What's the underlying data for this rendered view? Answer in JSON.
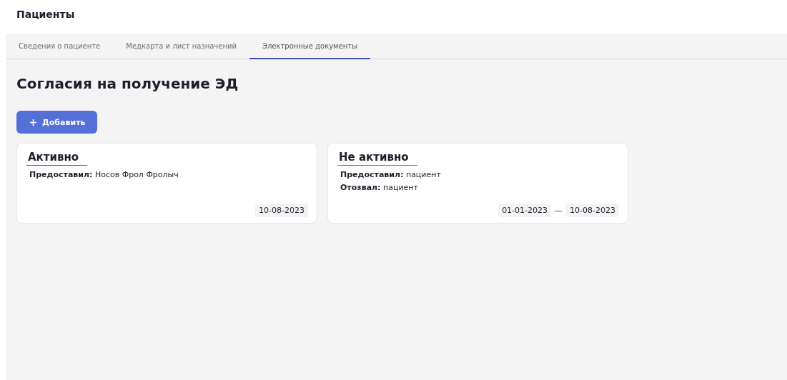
{
  "header": {
    "title": "Пациенты"
  },
  "tabs": [
    {
      "label": "Сведения о пациенте",
      "selected": false
    },
    {
      "label": "Медкарта и лист назначений",
      "selected": false
    },
    {
      "label": "Электронные документы",
      "selected": true
    }
  ],
  "section": {
    "heading": "Согласия на получение ЭД",
    "add_button": {
      "label": "Добавить"
    }
  },
  "cards": [
    {
      "status": "Активно",
      "color": "#3f63d6",
      "fields": [
        {
          "label": "Предоставил:",
          "value": "Носов Фрол Фролыч"
        }
      ],
      "dates": [
        "10-08-2023"
      ]
    },
    {
      "status": "Не активно",
      "color": "#f2541b",
      "fields": [
        {
          "label": "Предоставил:",
          "value": "пациент"
        },
        {
          "label": "Отозвал:",
          "value": "пациент"
        }
      ],
      "dates": [
        "01-01-2023",
        "10-08-2023"
      ],
      "separator": "—"
    }
  ]
}
